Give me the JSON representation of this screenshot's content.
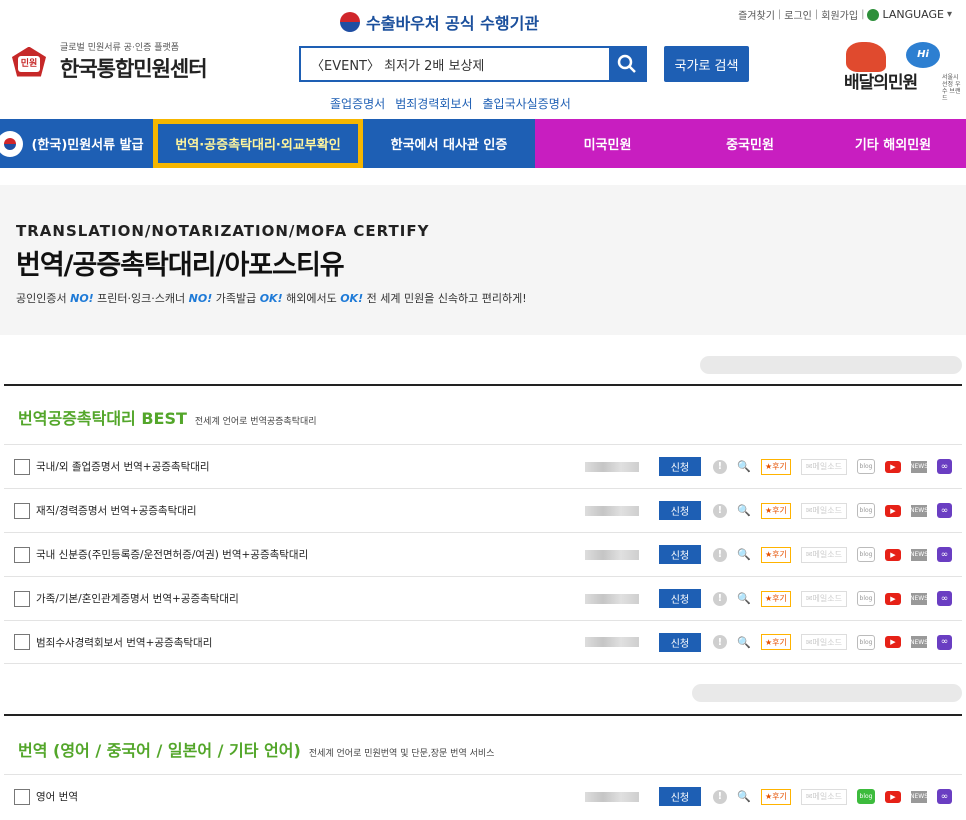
{
  "header": {
    "voucher_text": "수출바우처 공식 수행기관",
    "top_links": [
      "즐겨찾기",
      "로그인",
      "회원가입"
    ],
    "language_label": "LANGUAGE",
    "logo_sub": "글로벌 민원서류 공·인증 플랫폼",
    "logo_name": "한국통합민원센터",
    "logo_badge": "민원",
    "search_value": "〈EVENT〉 최저가 2배 보상제",
    "country_search_label": "국가로 검색",
    "quick_links": [
      "졸업증명서",
      "범죄경력회보서",
      "출입국사실증명서"
    ],
    "baedal_text": "배달의민원",
    "baedal_hi": "Hi Seoul",
    "baedal_small": "서울시 선정 우수 브랜드"
  },
  "nav": {
    "items": [
      {
        "label": "(한국)민원서류 발급",
        "color": "#1e5fb4"
      },
      {
        "label": "번역·공증촉탁대리·외교부확인",
        "color": "#1e5fb4",
        "highlight": true
      },
      {
        "label": "한국에서 대사관 인증",
        "color": "#1e5fb4"
      },
      {
        "label": "미국민원",
        "color": "#c81ec0"
      },
      {
        "label": "중국민원",
        "color": "#c81ec0"
      },
      {
        "label": "기타 해외민원",
        "color": "#c81ec0"
      }
    ]
  },
  "hero": {
    "english": "TRANSLATION/NOTARIZATION/MOFA CERTIFY",
    "korean": "번역/공증촉탁대리/아포스티유",
    "desc_parts": [
      "공인인증서 ",
      "NO!",
      " 프린터·잉크·스캐너 ",
      "NO!",
      " 가족발급 ",
      "OK!",
      " 해외에서도 ",
      "OK!",
      " 전 세계 민원을 신속하고 편리하게!"
    ]
  },
  "sections": [
    {
      "title": "번역공증촉탁대리 BEST",
      "desc": "전세계 언어로 번역공증촉탁대리",
      "rows": [
        {
          "label": "국내/외 졸업증명서 번역+공증촉탁대리"
        },
        {
          "label": "재직/경력증명서 번역+공증촉탁대리"
        },
        {
          "label": "국내 신분증(주민등록증/운전면허증/여권) 번역+공증촉탁대리"
        },
        {
          "label": "가족/기본/혼인관계증명서 번역+공증촉탁대리"
        },
        {
          "label": "범죄수사경력회보서 번역+공증촉탁대리"
        }
      ]
    },
    {
      "title": "번역 (영어 / 중국어 / 일본어 / 기타 언어)",
      "desc": "전세계 언어로 민원번역 및 단문,장문 번역 서비스",
      "rows": [
        {
          "label": "영어 번역"
        }
      ]
    }
  ],
  "row_actions": {
    "apply_label": "신청",
    "review_label": "★후기",
    "email_label": "✉메일소드"
  },
  "icons": {
    "info": "exclamation-icon",
    "doc": "document-search-icon",
    "blog": "blog-icon",
    "youtube": "youtube-icon",
    "news": "news-icon",
    "link": "link-icon"
  }
}
